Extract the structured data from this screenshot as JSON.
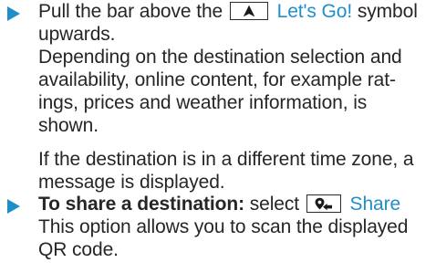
{
  "step1": {
    "line1_before": "Pull the bar above the",
    "line1_link": "Let's Go!",
    "line1_after": "symbol",
    "line2": "upwards.",
    "p1_lines": [
      "Depending on the destination selection and",
      "availability, online content, for example rat-",
      "ings, prices and weather information, is",
      "shown."
    ],
    "p2_lines": [
      "If the destination is in a different time zone, a",
      "message is displayed."
    ]
  },
  "step2": {
    "bold_label": "To share a destination:",
    "select_text": "select",
    "link": "Share",
    "lines": [
      "This option allows you to scan the displayed",
      "QR code."
    ]
  },
  "icons": {
    "bullet": "triangle-bullet-icon",
    "lets_go": "navigation-arrow-icon",
    "share": "location-share-icon"
  },
  "colors": {
    "accent": "#1f8fc8",
    "text": "#262626"
  }
}
